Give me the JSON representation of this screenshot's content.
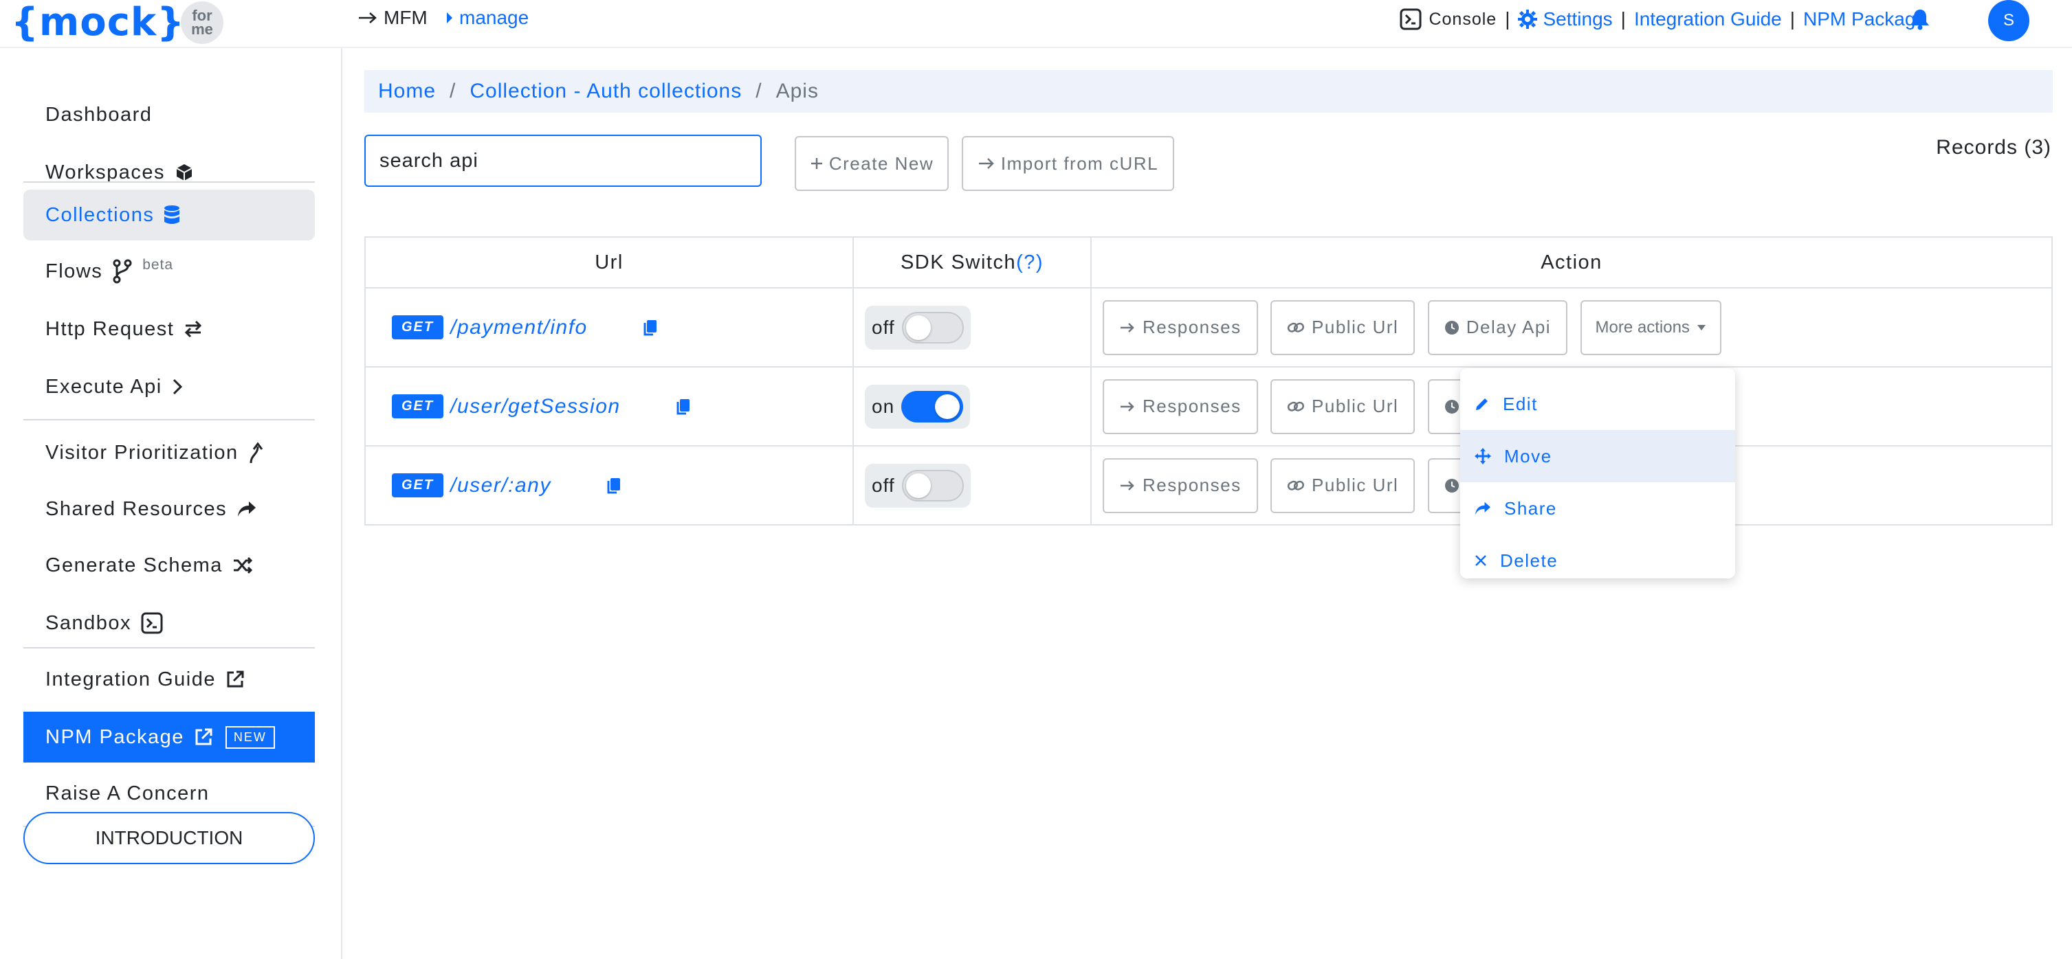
{
  "header": {
    "logo_main": "{mock}",
    "logo_badge_top": "for",
    "logo_badge_bottom": "me",
    "crumb_mfm": "MFM",
    "crumb_manage": "manage",
    "console_label": "Console",
    "settings_label": "Settings",
    "separator": "|",
    "integration_label": "Integration Guide",
    "npm_label": "NPM Package",
    "avatar_initial": "S"
  },
  "sidebar": {
    "items": [
      {
        "label": "Dashboard"
      },
      {
        "label": "Workspaces"
      },
      {
        "label": "Collections"
      },
      {
        "label": "Flows",
        "badge": "beta"
      },
      {
        "label": "Http Request"
      },
      {
        "label": "Execute Api"
      },
      {
        "label": "Visitor Prioritization"
      },
      {
        "label": "Shared Resources"
      },
      {
        "label": "Generate Schema"
      },
      {
        "label": "Sandbox"
      },
      {
        "label": "Integration Guide"
      },
      {
        "label": "NPM Package",
        "badge": "NEW"
      },
      {
        "label": "Raise A Concern"
      }
    ],
    "intro_button": "INTRODUCTION"
  },
  "breadcrumb": {
    "home": "Home",
    "sep": "/",
    "collection": "Collection - Auth collections",
    "current": "Apis"
  },
  "toolbar": {
    "search_value": "search api",
    "create_label": "Create New",
    "import_label": "Import from cURL",
    "records_label": "Records (3)"
  },
  "table": {
    "headers": {
      "url": "Url",
      "sdk": "SDK Switch",
      "sdk_help": "(?)",
      "action": "Action"
    },
    "rows": [
      {
        "method": "GET",
        "url": "/payment/info",
        "sdk_state": "off",
        "sdk_on": false
      },
      {
        "method": "GET",
        "url": "/user/getSession",
        "sdk_state": "on",
        "sdk_on": true
      },
      {
        "method": "GET",
        "url": "/user/:any",
        "sdk_state": "off",
        "sdk_on": false
      }
    ],
    "actions": {
      "responses": "Responses",
      "public_url": "Public Url",
      "delay_api": "Delay Api",
      "more": "More actions"
    }
  },
  "menu": {
    "items": [
      {
        "label": "Edit",
        "icon": "pencil-icon"
      },
      {
        "label": "Move",
        "icon": "move-icon"
      },
      {
        "label": "Share",
        "icon": "share-icon"
      },
      {
        "label": "Delete",
        "icon": "close-icon"
      }
    ]
  },
  "colors": {
    "accent": "#0d6efd",
    "muted": "#6c757d"
  }
}
